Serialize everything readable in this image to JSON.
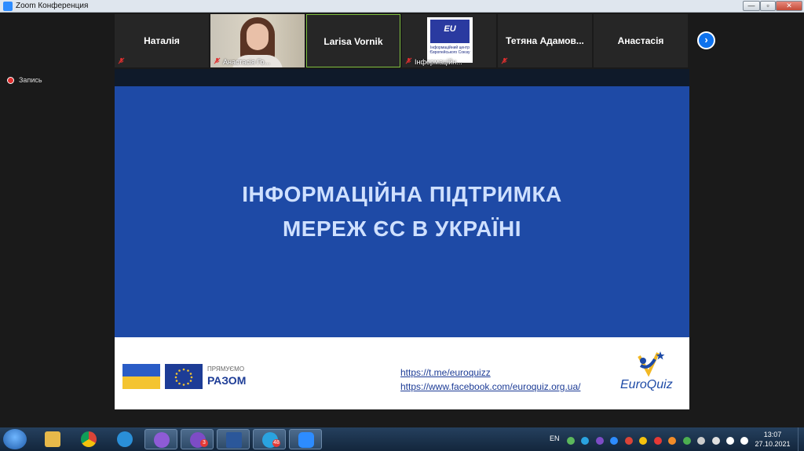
{
  "window": {
    "title": "Zoom Конференция",
    "buttons": {
      "minimize": "—",
      "maximize": "▫",
      "close": "✕"
    }
  },
  "recording": {
    "label": "Запись"
  },
  "participants": [
    {
      "name": "Наталія",
      "muted": true,
      "type": "name"
    },
    {
      "name": "Анастасія Го...",
      "muted": true,
      "type": "video"
    },
    {
      "name": "Larisa Vornik",
      "muted": false,
      "type": "name",
      "active": true
    },
    {
      "name": "Інформаційн...",
      "muted": true,
      "type": "logo"
    },
    {
      "name": "Тетяна Адамов...",
      "muted": true,
      "type": "name"
    },
    {
      "name": "Анастасія",
      "muted": false,
      "type": "name"
    }
  ],
  "next_page": "›",
  "logo_tile": {
    "mark": "EU",
    "text": "Інформаційний центр Європейського Союзу"
  },
  "slide": {
    "title_line1": "ІНФОРМАЦІЙНА ПІДТРИМКА",
    "title_line2": "МЕРЕЖ ЄС В УКРАЇНІ",
    "together_small": "ПРЯМУЄМО",
    "together_big": "РАЗОМ",
    "link1": "https://t.me/euroquizz",
    "link2": "https://www.facebook.com/euroquiz.org.ua/",
    "logo_word": "EuroQuiz"
  },
  "taskbar": {
    "apps": [
      {
        "name": "explorer",
        "color": "#e7b94a"
      },
      {
        "name": "chrome",
        "color": "#3c9d4e"
      },
      {
        "name": "internet-explorer",
        "color": "#2a8fd8"
      },
      {
        "name": "browser",
        "color": "#8e5bd6",
        "open": true
      },
      {
        "name": "viber",
        "color": "#7d4cc6",
        "open": true,
        "badge": "3"
      },
      {
        "name": "word",
        "color": "#2b579a",
        "open": true
      },
      {
        "name": "telegram",
        "color": "#2aa3e0",
        "open": true,
        "badge": "48"
      },
      {
        "name": "zoom",
        "color": "#2d8cff",
        "open": true
      }
    ],
    "language": "EN",
    "time": "13:07",
    "date": "27.10.2021"
  },
  "colors": {
    "slide_blue": "#1e4aa6",
    "slide_title": "#cfe0ff",
    "zoom_blue": "#0e72ed",
    "mute_red": "#e02f2f"
  }
}
